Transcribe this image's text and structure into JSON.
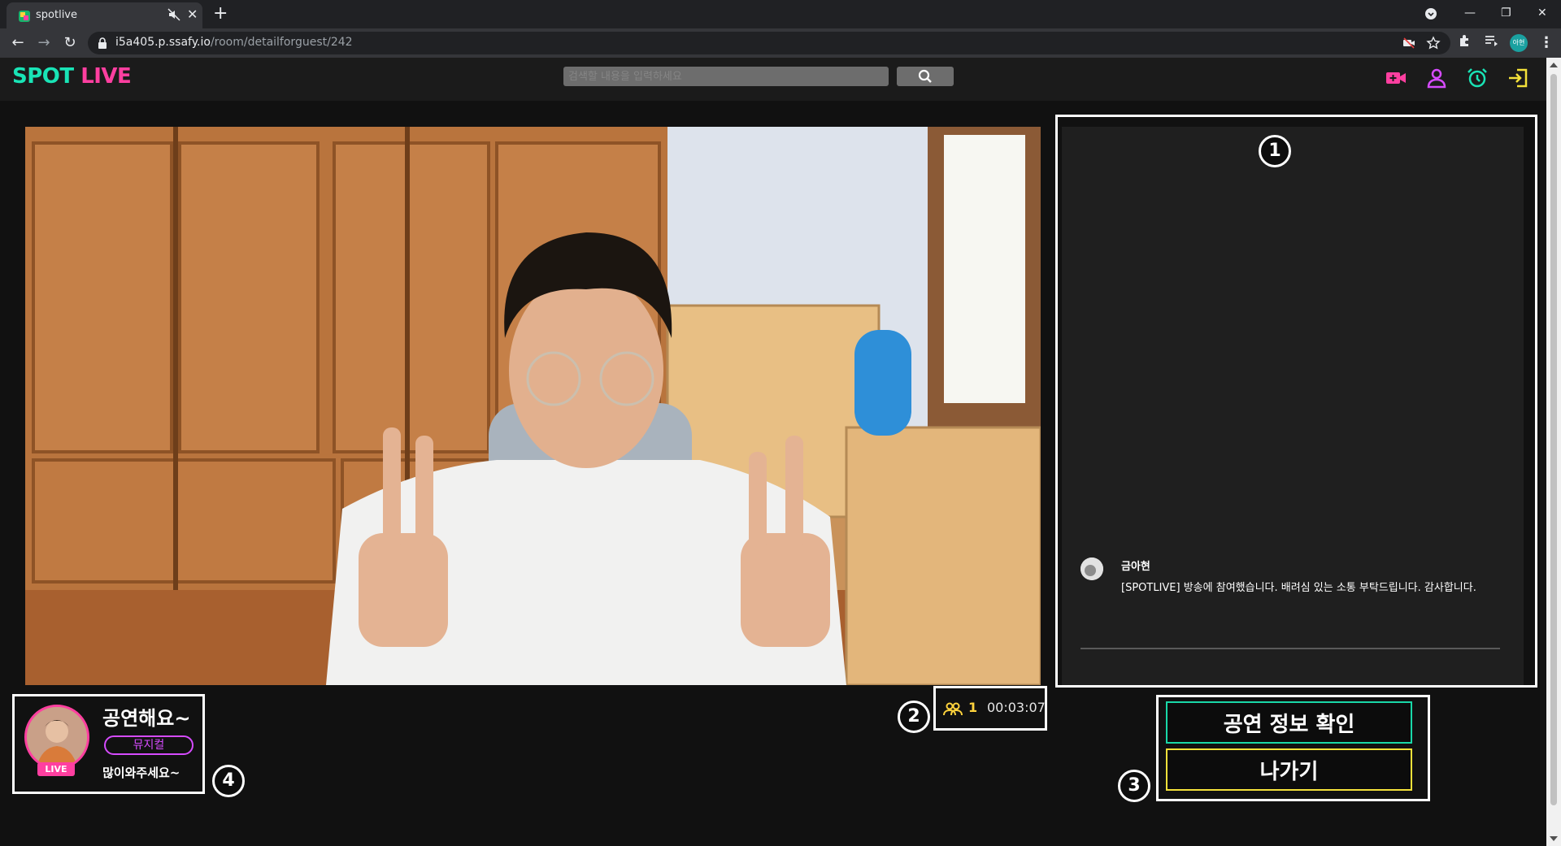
{
  "browser": {
    "tab_title": "spotlive",
    "new_tab": "+",
    "url_host": "i5a405.p.ssafy.io",
    "url_path": "/room/detailforguest/242",
    "profile_initials": "아현"
  },
  "app": {
    "logo_spot": "SPOT",
    "logo_live": "LIVE",
    "search_placeholder": "검색할 내용을 입력하세요"
  },
  "chat": {
    "messages": [
      {
        "author": "금아현",
        "text": "[SPOTLIVE] 방송에 참여했습니다. 배려심 있는 소통 부탁드립니다. 감사합니다."
      }
    ]
  },
  "stats": {
    "viewers": "1",
    "elapsed": "00:03:07"
  },
  "actions": {
    "info_label": "공연 정보 확인",
    "exit_label": "나가기"
  },
  "performer": {
    "title": "공연해요~",
    "genre": "뮤지컬",
    "description": "많이와주세요~",
    "live_badge": "LIVE"
  },
  "markers": [
    "1",
    "2",
    "3",
    "4"
  ],
  "colors": {
    "accent_green": "#19e4b6",
    "accent_pink": "#ff3fa0",
    "accent_purple": "#d64bff",
    "accent_yellow": "#f4e13a"
  },
  "icons": {
    "header": [
      "video-camera-icon",
      "user-icon",
      "alarm-clock-icon",
      "sign-in-icon"
    ],
    "stats": "viewers-icon"
  }
}
